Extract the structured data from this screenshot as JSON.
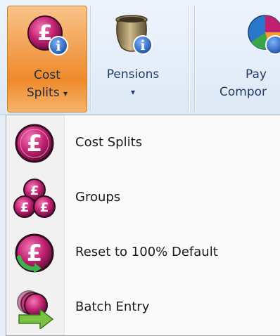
{
  "ribbon": {
    "cost_splits": {
      "line1": "Cost",
      "line2": "Splits",
      "arrow": "▾",
      "icon": "pound-coin-info-icon"
    },
    "pensions": {
      "line1": "Pensions",
      "arrow": "▾",
      "icon": "pension-pot-info-icon"
    },
    "pay_components": {
      "line1": "Pay",
      "line2": "Compor",
      "icon": "pie-chart-info-icon"
    }
  },
  "menu": {
    "items": [
      {
        "label": "Cost Splits",
        "icon": "pound-coin-icon"
      },
      {
        "label": "Groups",
        "icon": "pound-coins-group-icon"
      },
      {
        "label": "Reset to 100% Default",
        "icon": "pound-coin-reset-icon"
      },
      {
        "label": "Batch Entry",
        "icon": "pound-coin-batch-icon"
      }
    ]
  },
  "colors": {
    "active_button_orange": "#f2a253",
    "coin_magenta": "#c0206f",
    "info_blue": "#1f66c7"
  }
}
